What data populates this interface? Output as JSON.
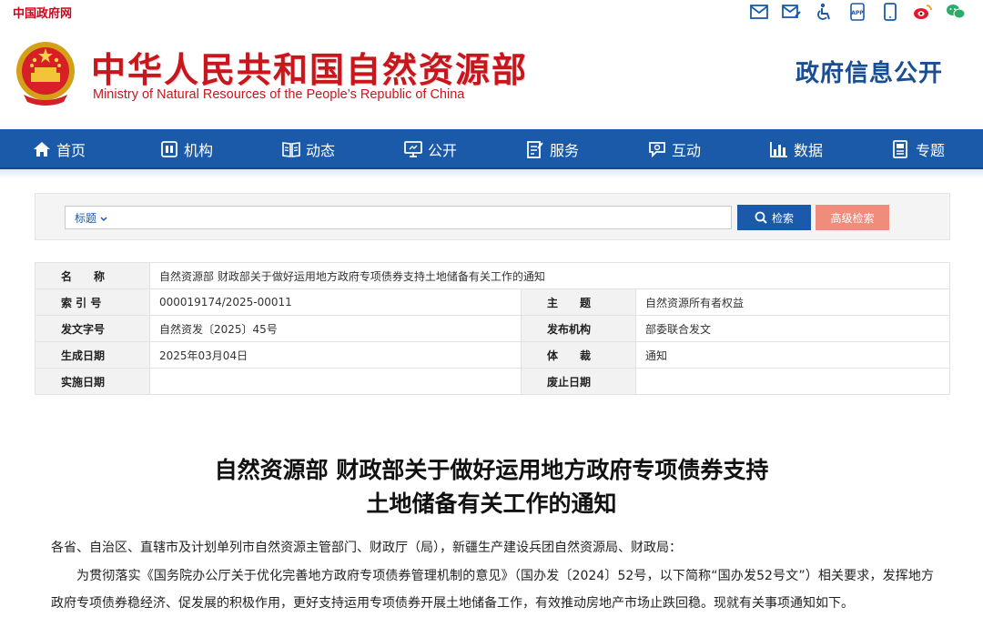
{
  "topbar": {
    "gov_link": "中国政府网",
    "icons": [
      "mail-icon",
      "mail-edit-icon",
      "accessibility-icon",
      "app-icon",
      "mobile-icon",
      "weibo-icon",
      "wechat-icon"
    ]
  },
  "header": {
    "title_cn": "中华人民共和国自然资源部",
    "title_en": "Ministry of Natural Resources of the People’s Republic of China",
    "section_title": "政府信息公开"
  },
  "nav": {
    "items": [
      {
        "label": "首页",
        "icon": "home-icon"
      },
      {
        "label": "机构",
        "icon": "org-icon"
      },
      {
        "label": "动态",
        "icon": "news-icon"
      },
      {
        "label": "公开",
        "icon": "disclosure-icon"
      },
      {
        "label": "服务",
        "icon": "service-icon"
      },
      {
        "label": "互动",
        "icon": "chat-icon"
      },
      {
        "label": "数据",
        "icon": "chart-icon"
      },
      {
        "label": "专题",
        "icon": "topic-icon"
      }
    ]
  },
  "search": {
    "select_label": "标题",
    "input_value": "",
    "search_button": "检索",
    "advanced_button": "高级检索"
  },
  "info": {
    "name_label": "名　　称",
    "name_value": "自然资源部 财政部关于做好运用地方政府专项债券支持土地储备有关工作的通知",
    "index_label": "索 引 号",
    "index_value": "000019174/2025-00011",
    "topic_label": "主　　题",
    "topic_value": "自然资源所有者权益",
    "docno_label": "发文字号",
    "docno_value": "自然资发〔2025〕45号",
    "issuer_label": "发布机构",
    "issuer_value": "部委联合发文",
    "date_label": "生成日期",
    "date_value": "2025年03月04日",
    "genre_label": "体　　裁",
    "genre_value": "通知",
    "effective_label": "实施日期",
    "effective_value": "",
    "expire_label": "废止日期",
    "expire_value": ""
  },
  "article": {
    "title_line1": "自然资源部 财政部关于做好运用地方政府专项债券支持",
    "title_line2": "土地储备有关工作的通知",
    "salutation": "各省、自治区、直辖市及计划单列市自然资源主管部门、财政厅（局），新疆生产建设兵团自然资源局、财政局：",
    "paragraph1": "为贯彻落实《国务院办公厅关于优化完善地方政府专项债券管理机制的意见》（国办发〔2024〕52号，以下简称“国办发52号文”）相关要求，发挥地方政府专项债券稳经济、促发展的积极作用，更好支持运用专项债券开展土地储备工作，有效推动房地产市场止跌回稳。现就有关事项通知如下。"
  },
  "colors": {
    "brand_red": "#c8161d",
    "nav_blue": "#1a5aa8",
    "section_blue": "#1a4e93",
    "advanced_button": "#f08c7c"
  }
}
